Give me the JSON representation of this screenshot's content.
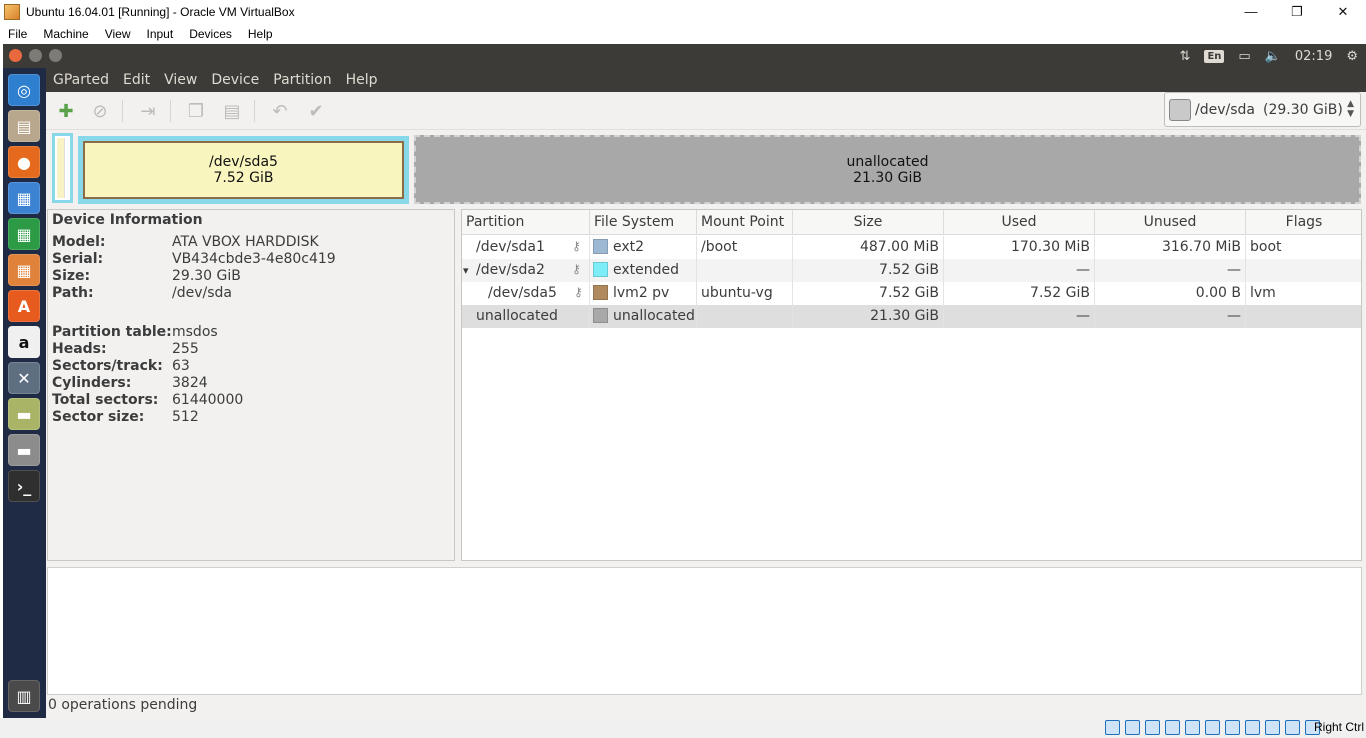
{
  "host_window": {
    "title": "Ubuntu 16.04.01 [Running] - Oracle VM VirtualBox",
    "menu": [
      "File",
      "Machine",
      "View",
      "Input",
      "Devices",
      "Help"
    ],
    "controls": {
      "minimize": "—",
      "restore": "❐",
      "close": "✕"
    }
  },
  "ubuntu_panel": {
    "keyboard_layout": "En",
    "clock": "02:19"
  },
  "launcher": {
    "items": [
      "ubuntu-dash",
      "files",
      "firefox",
      "libreoffice-writer",
      "libreoffice-calc",
      "libreoffice-impress",
      "ubuntu-software",
      "amazon",
      "system-settings",
      "gparted",
      "disks",
      "terminal",
      "trash"
    ]
  },
  "gparted": {
    "menu": [
      "GParted",
      "Edit",
      "View",
      "Device",
      "Partition",
      "Help"
    ],
    "device_selector": {
      "device": "/dev/sda",
      "size": "(29.30 GiB)"
    },
    "map": {
      "sda5_name": "/dev/sda5",
      "sda5_size": "7.52 GiB",
      "unalloc_name": "unallocated",
      "unalloc_size": "21.30 GiB"
    },
    "device_info": {
      "heading": "Device Information",
      "model_k": "Model:",
      "model_v": "ATA VBOX HARDDISK",
      "serial_k": "Serial:",
      "serial_v": "VB434cbde3-4e80c419",
      "size_k": "Size:",
      "size_v": "29.30 GiB",
      "path_k": "Path:",
      "path_v": "/dev/sda",
      "ptable_k": "Partition table:",
      "ptable_v": "msdos",
      "heads_k": "Heads:",
      "heads_v": "255",
      "sectors_k": "Sectors/track:",
      "sectors_v": "63",
      "cyl_k": "Cylinders:",
      "cyl_v": "3824",
      "total_k": "Total sectors:",
      "total_v": "61440000",
      "ssize_k": "Sector size:",
      "ssize_v": "512"
    },
    "table": {
      "columns": [
        "Partition",
        "File System",
        "Mount Point",
        "Size",
        "Used",
        "Unused",
        "Flags"
      ],
      "rows": [
        {
          "partition": "/dev/sda1",
          "fs": "ext2",
          "mount": "/boot",
          "size": "487.00 MiB",
          "used": "170.30 MiB",
          "unused": "316.70 MiB",
          "flags": "boot",
          "color": "#9db8d2"
        },
        {
          "expander": "▾",
          "partition": "/dev/sda2",
          "fs": "extended",
          "mount": "",
          "size": "7.52 GiB",
          "used": "—",
          "unused": "—",
          "flags": "",
          "color": "#7deef8"
        },
        {
          "partition": "/dev/sda5",
          "fs": "lvm2 pv",
          "mount": "ubuntu-vg",
          "size": "7.52 GiB",
          "used": "7.52 GiB",
          "unused": "0.00 B",
          "flags": "lvm",
          "color": "#b08a5e"
        },
        {
          "partition": "unallocated",
          "fs": "unallocated",
          "mount": "",
          "size": "21.30 GiB",
          "used": "—",
          "unused": "—",
          "flags": "",
          "color": "#a8a8a8"
        }
      ]
    },
    "status": "0 operations pending"
  },
  "vbox_status": {
    "host_key": "Right Ctrl"
  }
}
